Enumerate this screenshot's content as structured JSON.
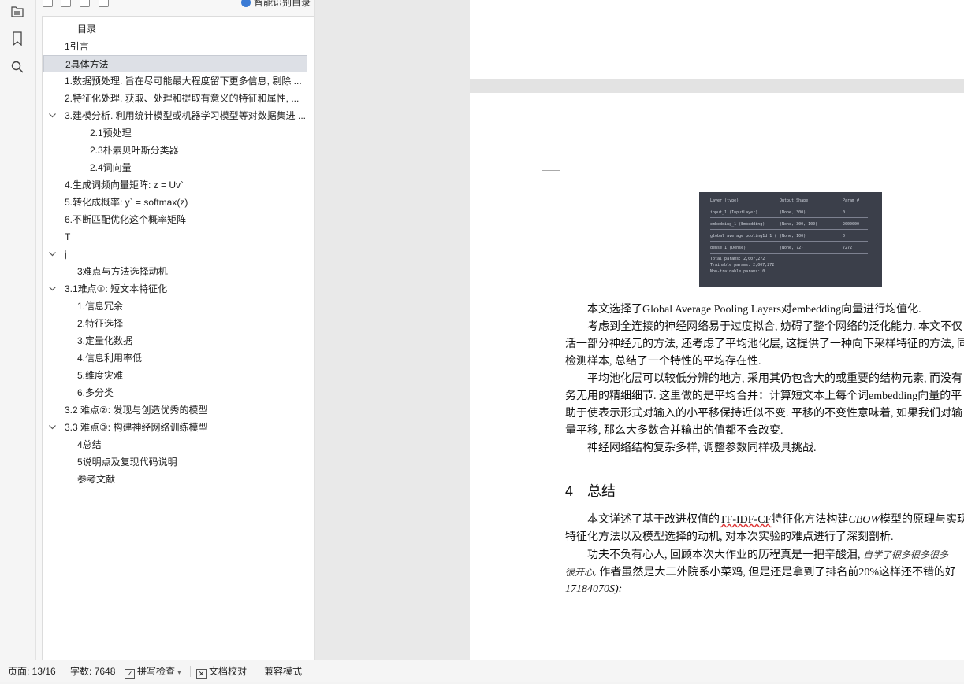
{
  "nav": {
    "smart_toc_label": "智能识别目录",
    "toc": [
      {
        "label": "目录",
        "level": 1,
        "expanded": null,
        "selected": false
      },
      {
        "label": "1引言",
        "level": 0,
        "expanded": null,
        "selected": false
      },
      {
        "label": "2具体方法",
        "level": 0,
        "expanded": null,
        "selected": true
      },
      {
        "label": "1.数据预处理. 旨在尽可能最大程度留下更多信息, 剔除 ...",
        "level": 0,
        "expanded": null,
        "selected": false
      },
      {
        "label": "2.特征化处理. 获取、处理和提取有意义的特征和属性, ...",
        "level": 0,
        "expanded": null,
        "selected": false
      },
      {
        "label": "3.建模分析. 利用统计模型或机器学习模型等对数据集进 ...",
        "level": 0,
        "expanded": true,
        "selected": false
      },
      {
        "label": "2.1预处理",
        "level": 2,
        "expanded": null,
        "selected": false
      },
      {
        "label": "2.3朴素贝叶斯分类器",
        "level": 2,
        "expanded": null,
        "selected": false
      },
      {
        "label": "2.4词向量",
        "level": 2,
        "expanded": null,
        "selected": false
      },
      {
        "label": "4.生成词频向量矩阵: z = Uv`",
        "level": 0,
        "expanded": null,
        "selected": false
      },
      {
        "label": "5.转化成概率: y`   = softmax(z)",
        "level": 0,
        "expanded": null,
        "selected": false
      },
      {
        "label": "6.不断匹配优化这个概率矩阵",
        "level": 0,
        "expanded": null,
        "selected": false
      },
      {
        "label": "T",
        "level": 0,
        "expanded": null,
        "selected": false
      },
      {
        "label": "j",
        "level": 0,
        "expanded": true,
        "selected": false
      },
      {
        "label": "3难点与方法选择动机",
        "level": 1,
        "expanded": null,
        "selected": false
      },
      {
        "label": "3.1难点①: 短文本特征化",
        "level": 0,
        "expanded": true,
        "selected": false
      },
      {
        "label": "1.信息冗余",
        "level": 1,
        "expanded": null,
        "selected": false
      },
      {
        "label": "2.特征选择",
        "level": 1,
        "expanded": null,
        "selected": false
      },
      {
        "label": "3.定量化数据",
        "level": 1,
        "expanded": null,
        "selected": false
      },
      {
        "label": "4.信息利用率低",
        "level": 1,
        "expanded": null,
        "selected": false
      },
      {
        "label": "5.维度灾难",
        "level": 1,
        "expanded": null,
        "selected": false
      },
      {
        "label": "6.多分类",
        "level": 1,
        "expanded": null,
        "selected": false
      },
      {
        "label": "3.2 难点②: 发现与创造优秀的模型",
        "level": 0,
        "expanded": null,
        "selected": false
      },
      {
        "label": "3.3 难点③: 构建神经网络训练模型",
        "level": 0,
        "expanded": true,
        "selected": false
      },
      {
        "label": "4总结",
        "level": 1,
        "expanded": null,
        "selected": false
      },
      {
        "label": "5说明点及复现代码说明",
        "level": 1,
        "expanded": null,
        "selected": false
      },
      {
        "label": "参考文献",
        "level": 1,
        "expanded": null,
        "selected": false
      }
    ]
  },
  "model_summary": {
    "header": [
      "Layer (type)",
      "Output Shape",
      "Param #"
    ],
    "rows": [
      [
        "input_1 (InputLayer)",
        "(None, 300)",
        "0"
      ],
      [
        "embedding_1 (Embedding)",
        "(None, 300, 100)",
        "2000000"
      ],
      [
        "global_average_pooling1d_1 (",
        "(None, 100)",
        "0"
      ],
      [
        "dense_1 (Dense)",
        "(None, 72)",
        "7272"
      ]
    ],
    "totals": [
      "Total params: 2,007,272",
      "Trainable params: 2,007,272",
      "Non-trainable params: 0"
    ]
  },
  "doc": {
    "p1": "本文选择了Global Average Pooling Layers对embedding向量进行均值化.",
    "p2_l1": "考虑到全连接的神经网络易于过度拟合, 妨碍了整个网络的泛化能力. 本文不仅",
    "p2_l2": "活一部分神经元的方法, 还考虑了平均池化层, 这提供了一种向下采样特征的方法, 同",
    "p2_l3": "检测样本, 总结了一个特性的平均存在性.",
    "p3_l1": "平均池化层可以较低分辨的地方, 采用其仍包含大的或重要的结构元素, 而没有",
    "p3_l2": "务无用的精细细节. 这里做的是平均合并：计算短文本上每个词embedding向量的平",
    "p3_l3": "助于使表示形式对输入的小平移保持近似不变. 平移的不变性意味着, 如果我们对输",
    "p3_l4": "量平移, 那么大多数合并输出的值都不会改变.",
    "p4": "神经网络结构复杂多样, 调整参数同样极具挑战.",
    "h4_num": "4",
    "h4_title": "总结",
    "p5_pre": "本文详述了基于改进权值的",
    "p5_wavy": "TF-IDF-CF",
    "p5_mid": "特征化方法构建",
    "p5_italic": "CBOW",
    "p5_post": "模型的原理与实现",
    "p5_l2": "特征化方法以及模型选择的动机, 对本次实验的难点进行了深刻剖析.",
    "p6_l1": "功夫不负有心人, 回顾本次大作业的历程真是一把辛酸泪,",
    "p6_hand1": "自学了很多很多很多",
    "p6_hand2": "很开心,",
    "p6_l2": "作者虽然是大二外院系小菜鸡, 但是还是拿到了排名前20%这样还不错的好",
    "p6_l3": "17184070S):"
  },
  "status": {
    "page": "页面: 13/16",
    "words": "字数: 7648",
    "spell": "拼写检查",
    "proof": "文档校对",
    "compat": "兼容模式"
  }
}
